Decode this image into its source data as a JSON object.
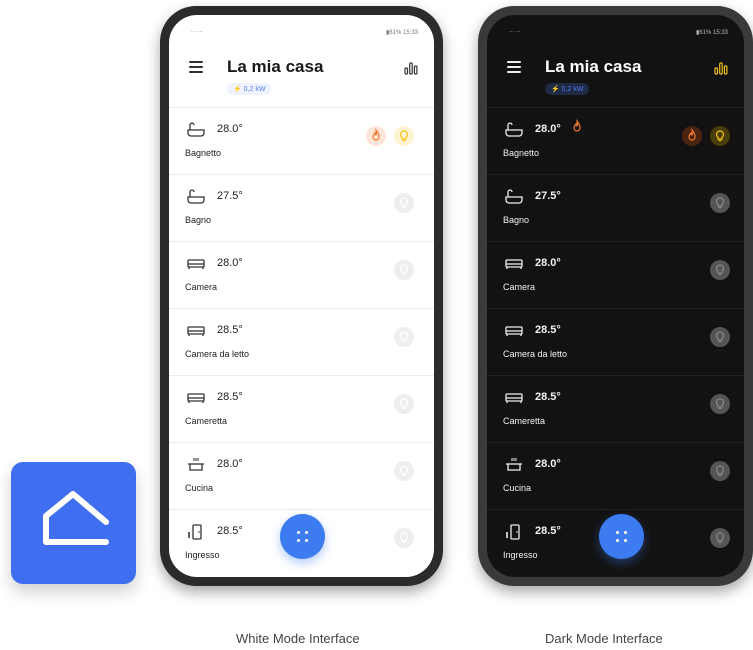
{
  "light": {
    "status_left": "∙∙∙ ∙∙∙",
    "status_right": "▮61% 15:33",
    "title": "La mia casa",
    "power": "⚡ 0,2 kW"
  },
  "dark": {
    "status_left": "∙∙∙ ∙∙∙",
    "status_right": "▮61% 15:33",
    "title": "La mia casa",
    "power": "⚡ 0,2 kW"
  },
  "rooms": [
    {
      "name": "Bagnetto",
      "temp": "28.0°",
      "icon": "bathtub-icon",
      "heating": true,
      "light_on": true
    },
    {
      "name": "Bagno",
      "temp": "27.5°",
      "icon": "bathtub-icon",
      "heating": false,
      "light_on": false
    },
    {
      "name": "Camera",
      "temp": "28.0°",
      "icon": "bed-icon",
      "heating": false,
      "light_on": false
    },
    {
      "name": "Camera da letto",
      "temp": "28.5°",
      "icon": "bed-icon",
      "heating": false,
      "light_on": false
    },
    {
      "name": "Cameretta",
      "temp": "28.5°",
      "icon": "bed-icon",
      "heating": false,
      "light_on": false
    },
    {
      "name": "Cucina",
      "temp": "28.0°",
      "icon": "cooking-pot-icon",
      "heating": false,
      "light_on": false
    },
    {
      "name": "Ingresso",
      "temp": "28.5°",
      "icon": "door-icon",
      "heating": false,
      "light_on": false
    }
  ],
  "captions": {
    "light": "White Mode Interface",
    "dark": "Dark Mode Interface"
  },
  "colors": {
    "accent": "#3c7bf0",
    "app_icon_bg": "#3f6ff0",
    "heat": "#f07a32",
    "bulb_on": "#f2c21a"
  }
}
